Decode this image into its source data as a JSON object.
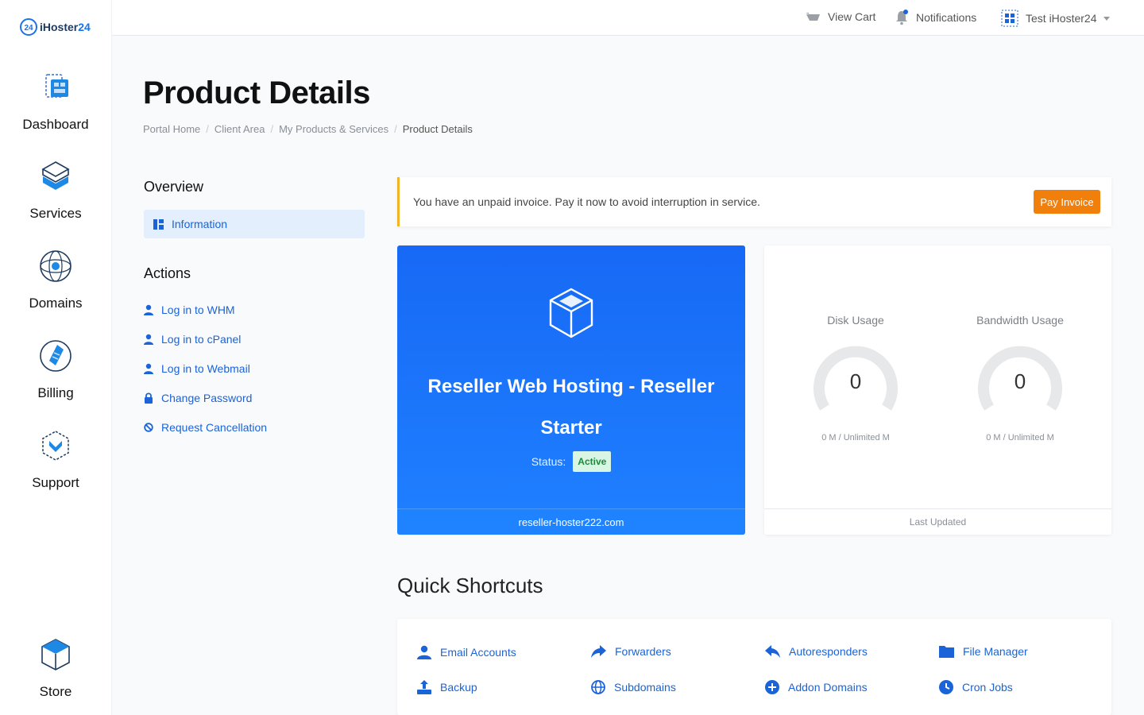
{
  "brand": {
    "logo_prefix": "24",
    "logo_text": "iHoster",
    "logo_suffix": "24"
  },
  "sidebar": {
    "items": [
      {
        "label": "Dashboard",
        "icon": "dashboard-icon"
      },
      {
        "label": "Services",
        "icon": "services-icon"
      },
      {
        "label": "Domains",
        "icon": "domains-icon"
      },
      {
        "label": "Billing",
        "icon": "billing-icon"
      },
      {
        "label": "Support",
        "icon": "support-icon"
      },
      {
        "label": "Store",
        "icon": "store-icon"
      }
    ]
  },
  "topbar": {
    "cart": "View Cart",
    "notifications": "Notifications",
    "account": "Test iHoster24"
  },
  "page": {
    "title": "Product Details",
    "breadcrumb": [
      "Portal Home",
      "Client Area",
      "My Products & Services",
      "Product Details"
    ]
  },
  "overview": {
    "title": "Overview",
    "information": "Information"
  },
  "actions": {
    "title": "Actions",
    "items": [
      {
        "label": "Log in to WHM",
        "icon": "user-icon"
      },
      {
        "label": "Log in to cPanel",
        "icon": "user-icon"
      },
      {
        "label": "Log in to Webmail",
        "icon": "user-icon"
      },
      {
        "label": "Change Password",
        "icon": "lock-icon"
      },
      {
        "label": "Request Cancellation",
        "icon": "ban-icon"
      }
    ]
  },
  "alert": {
    "message": "You have an unpaid invoice. Pay it now to avoid interruption in service.",
    "button": "Pay Invoice"
  },
  "product": {
    "name": "Reseller Web Hosting - Reseller Starter",
    "status_label": "Status:",
    "status": "Active",
    "domain": "reseller-hoster222.com"
  },
  "usage": {
    "disk": {
      "title": "Disk Usage",
      "value": "0",
      "detail": "0 M / Unlimited M"
    },
    "bandwidth": {
      "title": "Bandwidth Usage",
      "value": "0",
      "detail": "0 M / Unlimited M"
    },
    "footer": "Last Updated"
  },
  "shortcuts": {
    "title": "Quick Shortcuts",
    "items": [
      {
        "label": "Email Accounts",
        "icon": "user-icon"
      },
      {
        "label": "Forwarders",
        "icon": "forward-icon"
      },
      {
        "label": "Autoresponders",
        "icon": "reply-icon"
      },
      {
        "label": "File Manager",
        "icon": "folder-icon"
      },
      {
        "label": "Backup",
        "icon": "upload-icon"
      },
      {
        "label": "Subdomains",
        "icon": "globe-icon"
      },
      {
        "label": "Addon Domains",
        "icon": "plus-circle-icon"
      },
      {
        "label": "Cron Jobs",
        "icon": "clock-icon"
      }
    ]
  },
  "colors": {
    "accent": "#1a63d8",
    "card_blue": "#1769f5",
    "warning": "#f0b429",
    "pay_button": "#f07f0c",
    "active_badge": "#d9f5e3"
  }
}
